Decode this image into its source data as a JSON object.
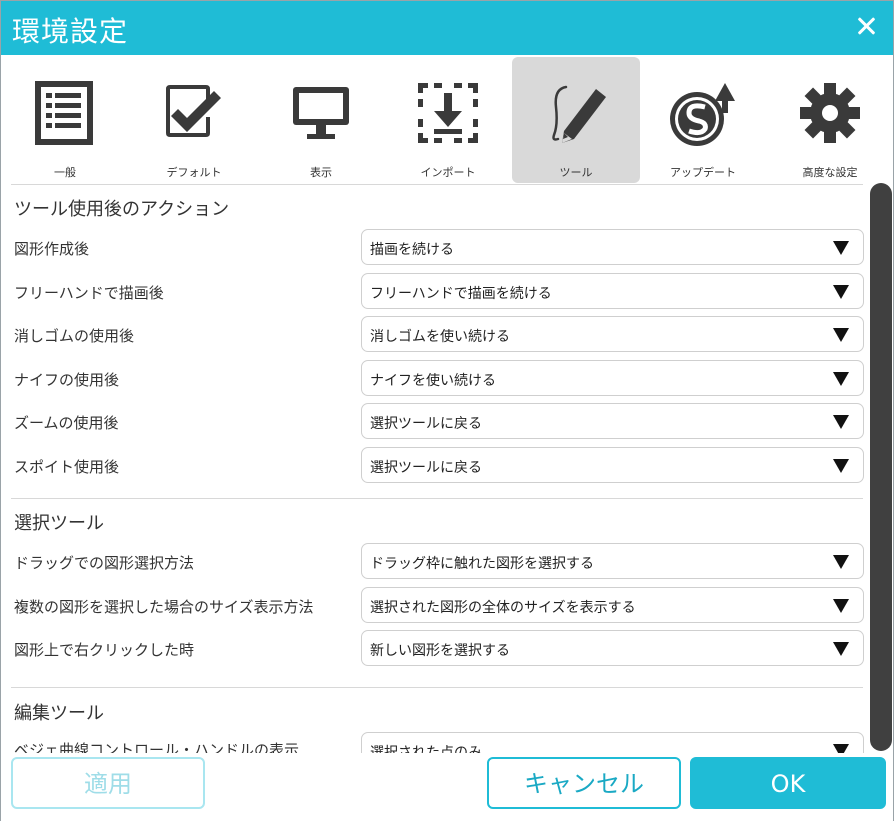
{
  "window": {
    "title": "環境設定"
  },
  "tabs": [
    {
      "label": "一般",
      "icon": "list-document-icon",
      "active": false
    },
    {
      "label": "デフォルト",
      "icon": "checkbox-icon",
      "active": false
    },
    {
      "label": "表示",
      "icon": "monitor-icon",
      "active": false
    },
    {
      "label": "インポート",
      "icon": "import-icon",
      "active": false
    },
    {
      "label": "ツール",
      "icon": "pen-icon",
      "active": true
    },
    {
      "label": "アップデート",
      "icon": "update-icon",
      "active": false
    },
    {
      "label": "高度な設定",
      "icon": "gear-icon",
      "active": false
    }
  ],
  "sections": [
    {
      "title": "ツール使用後のアクション",
      "rows": [
        {
          "label": "図形作成後",
          "value": "描画を続ける"
        },
        {
          "label": "フリーハンドで描画後",
          "value": "フリーハンドで描画を続ける"
        },
        {
          "label": "消しゴムの使用後",
          "value": "消しゴムを使い続ける"
        },
        {
          "label": "ナイフの使用後",
          "value": "ナイフを使い続ける"
        },
        {
          "label": "ズームの使用後",
          "value": "選択ツールに戻る"
        },
        {
          "label": "スポイト使用後",
          "value": "選択ツールに戻る"
        }
      ]
    },
    {
      "title": "選択ツール",
      "rows": [
        {
          "label": "ドラッグでの図形選択方法",
          "value": "ドラッグ枠に触れた図形を選択する"
        },
        {
          "label": "複数の図形を選択した場合のサイズ表示方法",
          "value": "選択された図形の全体のサイズを表示する"
        },
        {
          "label": "図形上で右クリックした時",
          "value": "新しい図形を選択する"
        }
      ]
    },
    {
      "title": "編集ツール",
      "rows": [
        {
          "label": "ベジェ曲線コントロール・ハンドルの表示",
          "value": "選択された点のみ"
        }
      ]
    }
  ],
  "footer": {
    "apply": "適用",
    "cancel": "キャンセル",
    "ok": "OK"
  },
  "colors": {
    "accent": "#1fbcd6",
    "active_tab": "#d9d9d9",
    "scrollbar": "#404040"
  }
}
